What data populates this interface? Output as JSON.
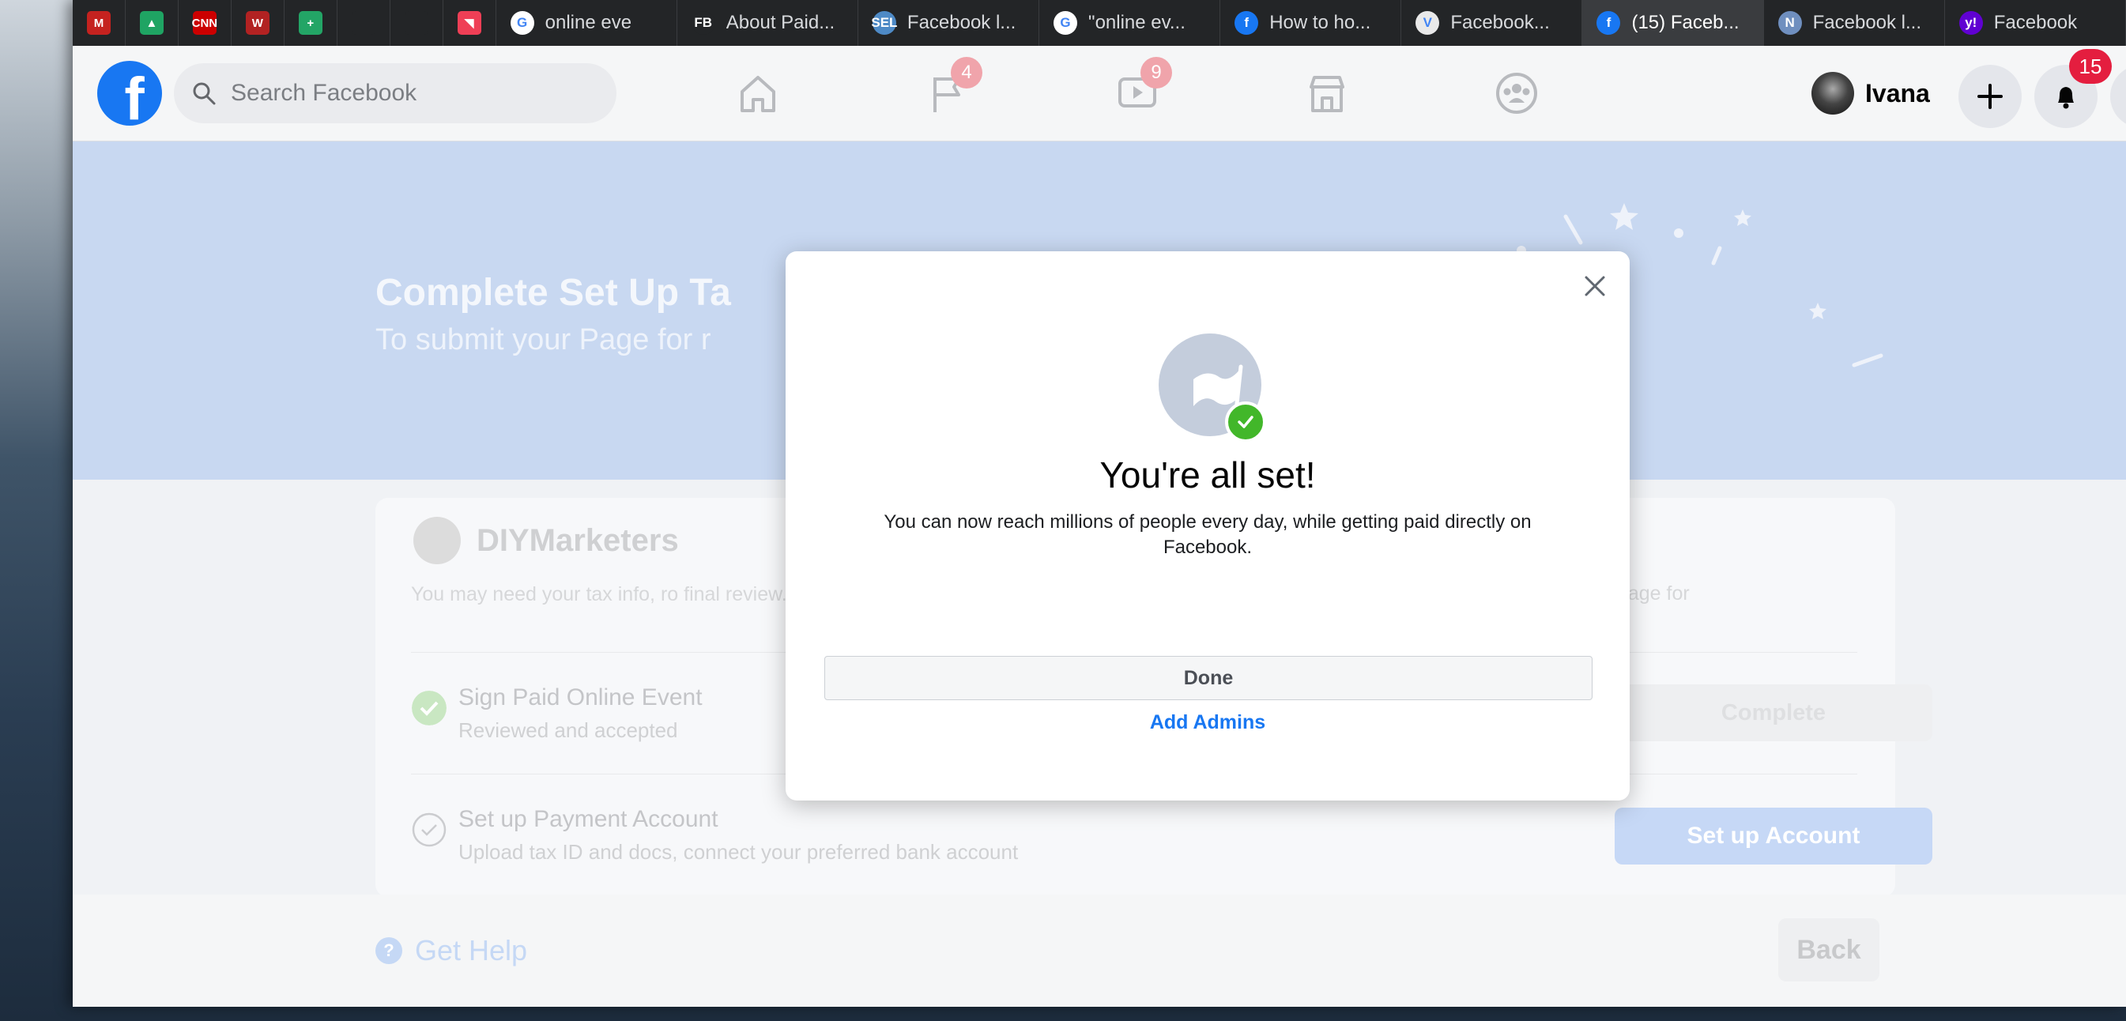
{
  "colors": {
    "fb_blue": "#1877f2",
    "hero_bg": "#c8d8f1",
    "success_green": "#42b72a",
    "notification_red": "#e41e3f"
  },
  "browser": {
    "pinned_tabs": [
      {
        "icon": "gmail-icon",
        "color": "#c5221f",
        "glyph": "M"
      },
      {
        "icon": "google-drive-icon",
        "color": "#1fa463",
        "glyph": "▲"
      },
      {
        "icon": "cnn-icon",
        "color": "#cc0000",
        "glyph": "CNN"
      },
      {
        "icon": "w-icon",
        "color": "#b22222",
        "glyph": "W"
      },
      {
        "icon": "google-sheets-icon",
        "color": "#23a566",
        "glyph": "+"
      },
      {
        "icon": "blank-icon",
        "color": "#232527",
        "glyph": ""
      },
      {
        "icon": "blank-icon",
        "color": "#232527",
        "glyph": ""
      },
      {
        "icon": "pocket-icon",
        "color": "#ef3f56",
        "glyph": "◥"
      }
    ],
    "tabs": [
      {
        "title": "online eve",
        "icon": "google-icon",
        "color": "#ffffff",
        "glyph": "G",
        "active": false
      },
      {
        "title": "About Paid...",
        "icon": "fb-text-icon",
        "color": "#232527",
        "glyph": "FB",
        "active": false
      },
      {
        "title": "Facebook l...",
        "icon": "sel-icon",
        "color": "#4e8ac6",
        "glyph": "SEL",
        "active": false
      },
      {
        "title": "\"online ev...",
        "icon": "google-icon",
        "color": "#ffffff",
        "glyph": "G",
        "active": false
      },
      {
        "title": "How to ho...",
        "icon": "facebook-icon",
        "color": "#1877f2",
        "glyph": "f",
        "active": false
      },
      {
        "title": "Facebook...",
        "icon": "v-icon",
        "color": "#e9e9e9",
        "glyph": "V",
        "active": false
      },
      {
        "title": "(15) Faceb...",
        "icon": "facebook-icon",
        "color": "#1877f2",
        "glyph": "f",
        "active": true
      },
      {
        "title": "Facebook l...",
        "icon": "n-icon",
        "color": "#6f8fbf",
        "glyph": "N",
        "active": false
      },
      {
        "title": "Facebook",
        "icon": "yahoo-icon",
        "color": "#6001d2",
        "glyph": "y!",
        "active": false
      }
    ]
  },
  "header": {
    "search_placeholder": "Search Facebook",
    "pages_badge": "4",
    "watch_badge": "9",
    "user_name": "Ivana",
    "notifications_badge": "15"
  },
  "hero": {
    "title": "Complete Set Up Ta",
    "subtitle": "To submit your Page for r"
  },
  "card": {
    "page_name": "DIYMarketers",
    "desc_left": "You may need your tax info, ro final review.",
    "desc_right": "able to submit your Page for",
    "step1_title": "Sign Paid Online Event",
    "step1_sub": "Reviewed and accepted",
    "step1_button": "Complete",
    "step2_title": "Set up Payment Account",
    "step2_sub": "Upload tax ID and docs, connect your preferred bank account",
    "step2_button": "Set up Account"
  },
  "footer": {
    "help_label": "Get Help",
    "back_label": "Back"
  },
  "modal": {
    "title": "You're all set!",
    "body": "You can now reach millions of people every day, while getting paid directly on Facebook.",
    "done_label": "Done",
    "add_admins_label": "Add Admins"
  }
}
